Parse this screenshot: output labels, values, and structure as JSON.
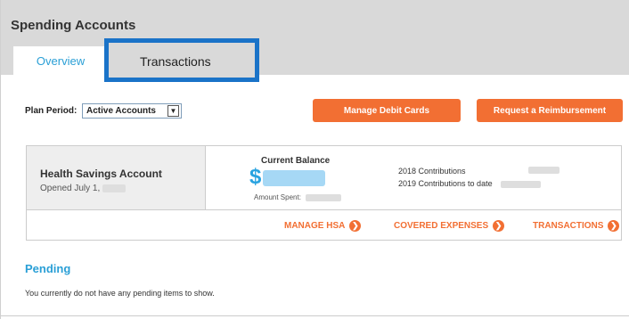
{
  "header": {
    "title": "Spending Accounts"
  },
  "tabs": [
    {
      "label": "Overview",
      "active": true
    },
    {
      "label": "Transactions",
      "highlighted": true
    }
  ],
  "plan_period": {
    "label": "Plan Period:",
    "selected": "Active Accounts"
  },
  "buttons": {
    "manage_debit": "Manage Debit Cards",
    "request_reimbursement": "Request a Reimbursement"
  },
  "account": {
    "name": "Health Savings Account",
    "opened_prefix": "Opened July 1,",
    "current_balance_label": "Current Balance",
    "currency_symbol": "$",
    "amount_spent_label": "Amount Spent:",
    "contrib_2018_label": "2018 Contributions",
    "contrib_2019_label": "2019 Contributions to date",
    "links": {
      "manage": "MANAGE HSA",
      "covered": "COVERED EXPENSES",
      "transactions": "TRANSACTIONS"
    }
  },
  "pending": {
    "title": "Pending",
    "message": "You currently do not have any pending items to show."
  },
  "colors": {
    "accent_orange": "#f26f33",
    "accent_blue": "#2a9fd6",
    "highlight_border": "#1a73c8"
  }
}
